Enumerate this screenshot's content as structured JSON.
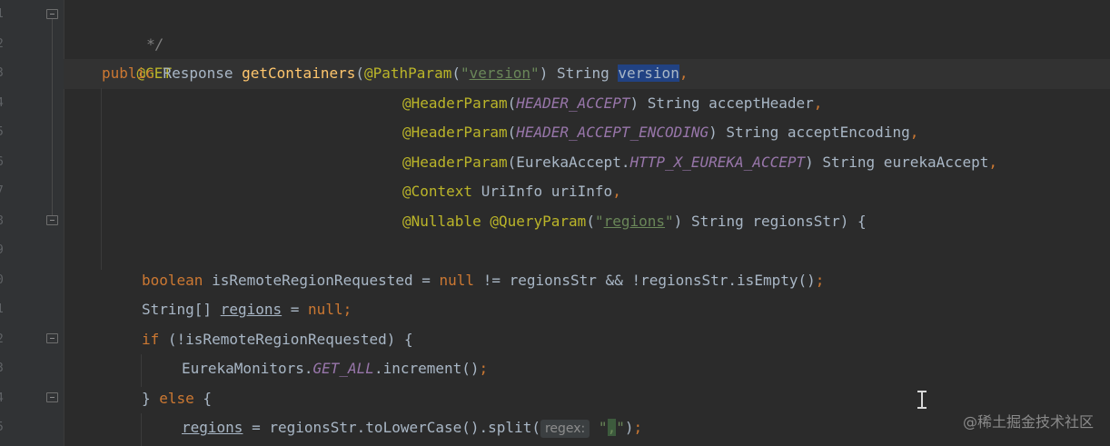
{
  "gutter": {
    "line_numbers": [
      "1",
      "2",
      "3",
      "4",
      "5",
      "6",
      "7",
      "8",
      "9",
      "0",
      "1",
      "2",
      "3",
      "4",
      "5"
    ]
  },
  "code": {
    "l0_comment": " */",
    "l1_annotation": "@GET",
    "l2": {
      "kw_public": "public",
      "t1": " Response ",
      "method": "getContainers",
      "t2": "(",
      "ann": "@PathParam",
      "t3": "(",
      "q1": "\"",
      "str": "version",
      "q2": "\"",
      "t4": ") String ",
      "param_selected": "version",
      "comma": ","
    },
    "l3": {
      "ann": "@HeaderParam",
      "t1": "(",
      "const": "HEADER_ACCEPT",
      "t2": ") String acceptHeader",
      "comma": ","
    },
    "l4": {
      "ann": "@HeaderParam",
      "t1": "(",
      "const": "HEADER_ACCEPT_ENCODING",
      "t2": ") String acceptEncoding",
      "comma": ","
    },
    "l5": {
      "ann": "@HeaderParam",
      "t1": "(EurekaAccept.",
      "const": "HTTP_X_EUREKA_ACCEPT",
      "t2": ") String eurekaAccept",
      "comma": ","
    },
    "l6": {
      "ann": "@Context",
      "t1": " UriInfo uriInfo",
      "comma": ","
    },
    "l7": {
      "ann1": "@Nullable",
      "sp": " ",
      "ann2": "@QueryParam",
      "t1": "(",
      "q1": "\"",
      "str": "regions",
      "q2": "\"",
      "t2": ") String regionsStr) {"
    },
    "l9": {
      "kw_boolean": "boolean",
      "t1": " isRemoteRegionRequested = ",
      "kw_null": "null",
      "t2": " != regionsStr && !regionsStr.isEmpty()",
      "semi": ";"
    },
    "l10": {
      "t1": "String[] ",
      "var": "regions",
      "t2": " = ",
      "kw_null": "null",
      "semi": ";"
    },
    "l11": {
      "kw_if": "if",
      "t1": " (!isRemoteRegionRequested) {"
    },
    "l12": {
      "t1": "EurekaMonitors.",
      "const": "GET_ALL",
      "t2": ".increment()",
      "semi": ";"
    },
    "l13": {
      "t1": "} ",
      "kw_else": "else",
      "t2": " {"
    },
    "l14": {
      "var": "regions",
      "t1": " = regionsStr.toLowerCase().split(",
      "hint": "regex:",
      "sp": " ",
      "q1": "\"",
      "comma": ",",
      "q2": "\"",
      "t2": ")",
      "semi": ";"
    }
  },
  "watermark": "@稀土掘金技术社区",
  "colors": {
    "background": "#2b2b2b",
    "gutter": "#313335",
    "keyword": "#cc7832",
    "annotation": "#bbb529",
    "string": "#6a8759",
    "constant": "#9876aa",
    "method": "#ffc66d",
    "text": "#a9b7c6",
    "selection": "#214283"
  }
}
